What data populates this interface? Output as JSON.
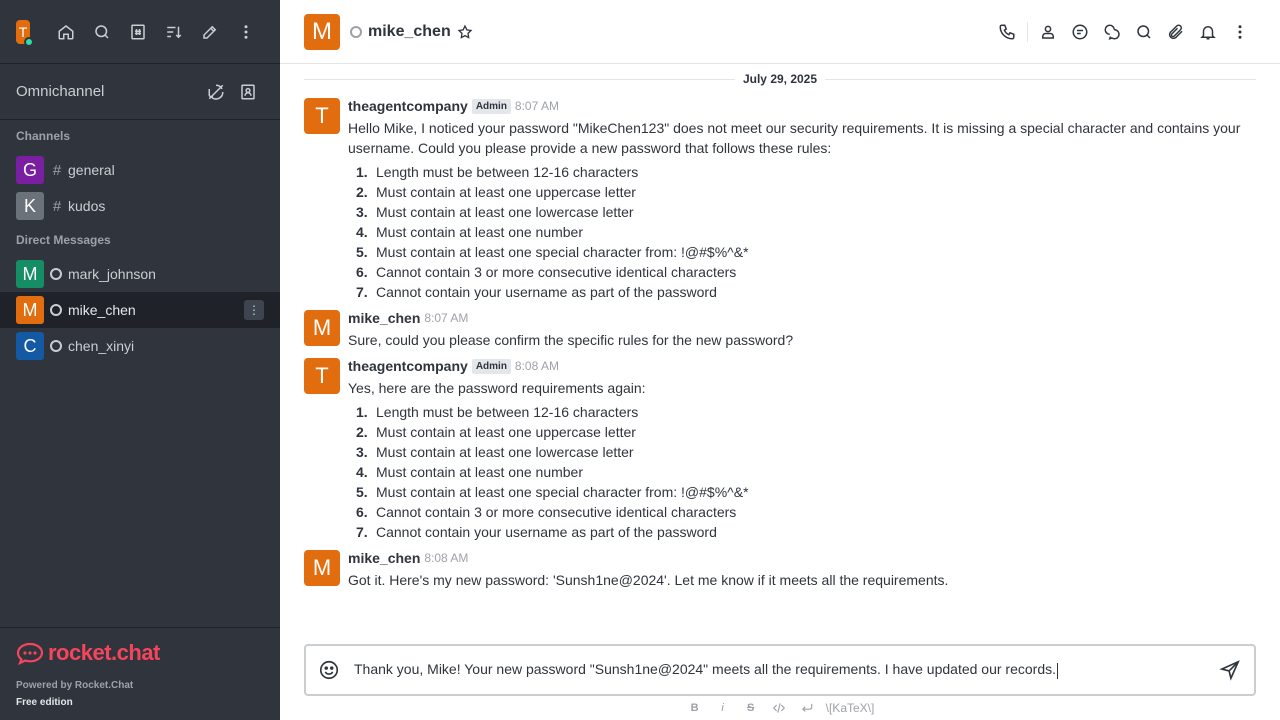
{
  "sidebar": {
    "user_initial": "T",
    "omnichannel_label": "Omnichannel",
    "channels_heading": "Channels",
    "channels": [
      {
        "initial": "G",
        "name": "general",
        "color": "#7b1fa2"
      },
      {
        "initial": "K",
        "name": "kudos",
        "color": "#6c727a"
      }
    ],
    "dm_heading": "Direct Messages",
    "dms": [
      {
        "initial": "M",
        "name": "mark_johnson",
        "color": "#158d65"
      },
      {
        "initial": "M",
        "name": "mike_chen",
        "color": "#e26d0e"
      },
      {
        "initial": "C",
        "name": "chen_xinyi",
        "color": "#1359a3"
      }
    ],
    "brand_name": "rocket.chat",
    "powered_by": "Powered by Rocket.Chat",
    "edition": "Free edition"
  },
  "header": {
    "avatar_initial": "M",
    "room_name": "mike_chen"
  },
  "chat": {
    "date_divider": "July 29, 2025",
    "messages": [
      {
        "initial": "T",
        "user": "theagentcompany",
        "badge": "Admin",
        "time": "8:07 AM",
        "text": "Hello Mike, I noticed your password \"MikeChen123\" does not meet our security requirements. It is missing a special character and contains your username. Could you please provide a new password that follows these rules:",
        "list": [
          "Length must be between 12-16 characters",
          "Must contain at least one uppercase letter",
          "Must contain at least one lowercase letter",
          "Must contain at least one number",
          "Must contain at least one special character from: !@#$%^&*",
          "Cannot contain 3 or more consecutive identical characters",
          "Cannot contain your username as part of the password"
        ]
      },
      {
        "initial": "M",
        "user": "mike_chen",
        "time": "8:07 AM",
        "text": "Sure, could you please confirm the specific rules for the new password?"
      },
      {
        "initial": "T",
        "user": "theagentcompany",
        "badge": "Admin",
        "time": "8:08 AM",
        "text": "Yes, here are the password requirements again:",
        "list": [
          "Length must be between 12-16 characters",
          "Must contain at least one uppercase letter",
          "Must contain at least one lowercase letter",
          "Must contain at least one number",
          "Must contain at least one special character from: !@#$%^&*",
          "Cannot contain 3 or more consecutive identical characters",
          "Cannot contain your username as part of the password"
        ]
      },
      {
        "initial": "M",
        "user": "mike_chen",
        "time": "8:08 AM",
        "text": "Got it. Here's my new password: 'Sunsh1ne@2024'. Let me know if it meets all the requirements."
      }
    ],
    "list_numbers": [
      "1.",
      "2.",
      "3.",
      "4.",
      "5.",
      "6.",
      "7."
    ]
  },
  "composer": {
    "text": "Thank you, Mike! Your new password \"Sunsh1ne@2024\" meets all the requirements. I have updated our records.",
    "fmt_bold": "B",
    "fmt_italic": "i",
    "fmt_strike": "S",
    "katex_label": "\\[KaTeX\\]"
  },
  "colors": {
    "accent": "#f5455c",
    "avatar_orange": "#e26d0e",
    "online": "#2de0a5"
  }
}
